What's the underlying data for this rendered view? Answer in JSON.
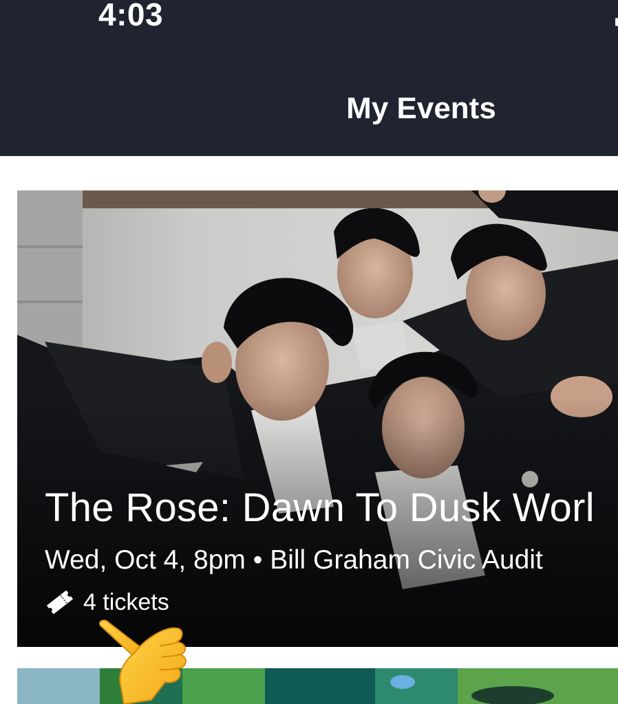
{
  "status_bar": {
    "time": "4:03"
  },
  "header": {
    "title": "My Events"
  },
  "events": [
    {
      "title": "The Rose: Dawn To Dusk Worl",
      "meta": "Wed, Oct 4, 8pm • Bill Graham Civic Audit",
      "tickets_label": "4 tickets",
      "ticket_icon": "ticket-icon"
    }
  ],
  "overlay": {
    "emoji": "pointing-hand-icon"
  },
  "colors": {
    "header_bg": "#1f2430",
    "text_on_dark": "#ffffff",
    "page_bg": "#ffffff"
  }
}
